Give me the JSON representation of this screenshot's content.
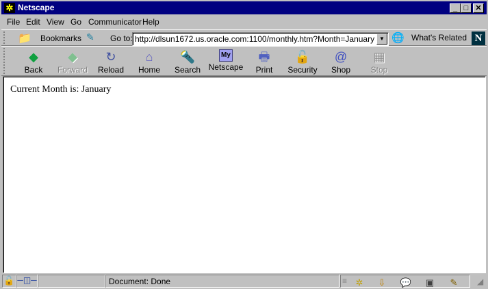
{
  "window": {
    "title": "Netscape",
    "minimize": "_",
    "maximize": "□",
    "close": "✕"
  },
  "menu": [
    "File",
    "Edit",
    "View",
    "Go",
    "Communicator",
    "Help"
  ],
  "location": {
    "bookmarks_label": "Bookmarks",
    "goto_label": "Go to:",
    "url": "http://dlsun1672.us.oracle.com:1100/monthly.htm?Month=January",
    "whats_related": "What's Related"
  },
  "toolbar": [
    {
      "label": "Back",
      "icon": "back-icon",
      "enabled": true
    },
    {
      "label": "Forward",
      "icon": "forward-icon",
      "enabled": false
    },
    {
      "label": "Reload",
      "icon": "reload-icon",
      "enabled": true
    },
    {
      "label": "Home",
      "icon": "home-icon",
      "enabled": true
    },
    {
      "label": "Search",
      "icon": "search-icon",
      "enabled": true
    },
    {
      "label": "Netscape",
      "icon": "my-netscape-icon",
      "enabled": true
    },
    {
      "label": "Print",
      "icon": "print-icon",
      "enabled": true
    },
    {
      "label": "Security",
      "icon": "security-icon",
      "enabled": true
    },
    {
      "label": "Shop",
      "icon": "shop-icon",
      "enabled": true
    },
    {
      "label": "Stop",
      "icon": "stop-icon",
      "enabled": false
    }
  ],
  "content": {
    "text": "Current Month is: January"
  },
  "status": {
    "text": "Document: Done"
  },
  "colors": {
    "titlebar": "#000080",
    "chrome": "#c0c0c0"
  }
}
